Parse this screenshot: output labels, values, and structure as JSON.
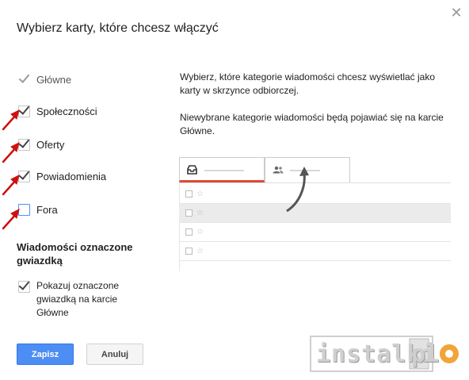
{
  "dialog": {
    "title": "Wybierz karty, które chcesz włączyć",
    "close_icon": "close-icon"
  },
  "tabs_options": [
    {
      "label": "Główne",
      "checked": true,
      "disabled": true
    },
    {
      "label": "Społeczności",
      "checked": true,
      "disabled": false
    },
    {
      "label": "Oferty",
      "checked": true,
      "disabled": false
    },
    {
      "label": "Powiadomienia",
      "checked": true,
      "disabled": false
    },
    {
      "label": "Fora",
      "checked": false,
      "disabled": false
    }
  ],
  "starred_section": {
    "title": "Wiadomości oznaczone gwiazdką",
    "option_label": "Pokazuj oznaczone gwiazdką na karcie Główne",
    "checked": true
  },
  "buttons": {
    "save_label": "Zapisz",
    "cancel_label": "Anuluj"
  },
  "description": {
    "line1": "Wybierz, które kategorie wiadomości chcesz wyświetlać jako karty w skrzynce odbiorczej.",
    "line2": "Niewybrane kategorie wiadomości będą pojawiać się na karcie Główne."
  },
  "preview": {
    "tab_icons": [
      "inbox-icon",
      "people-icon"
    ],
    "rows": 4
  },
  "colors": {
    "accent_blue": "#4d8ef4",
    "arrow_red": "#cc1111",
    "tab_active": "#dd4b39"
  },
  "watermark": {
    "text": "instalki",
    "suffix": "pl"
  }
}
